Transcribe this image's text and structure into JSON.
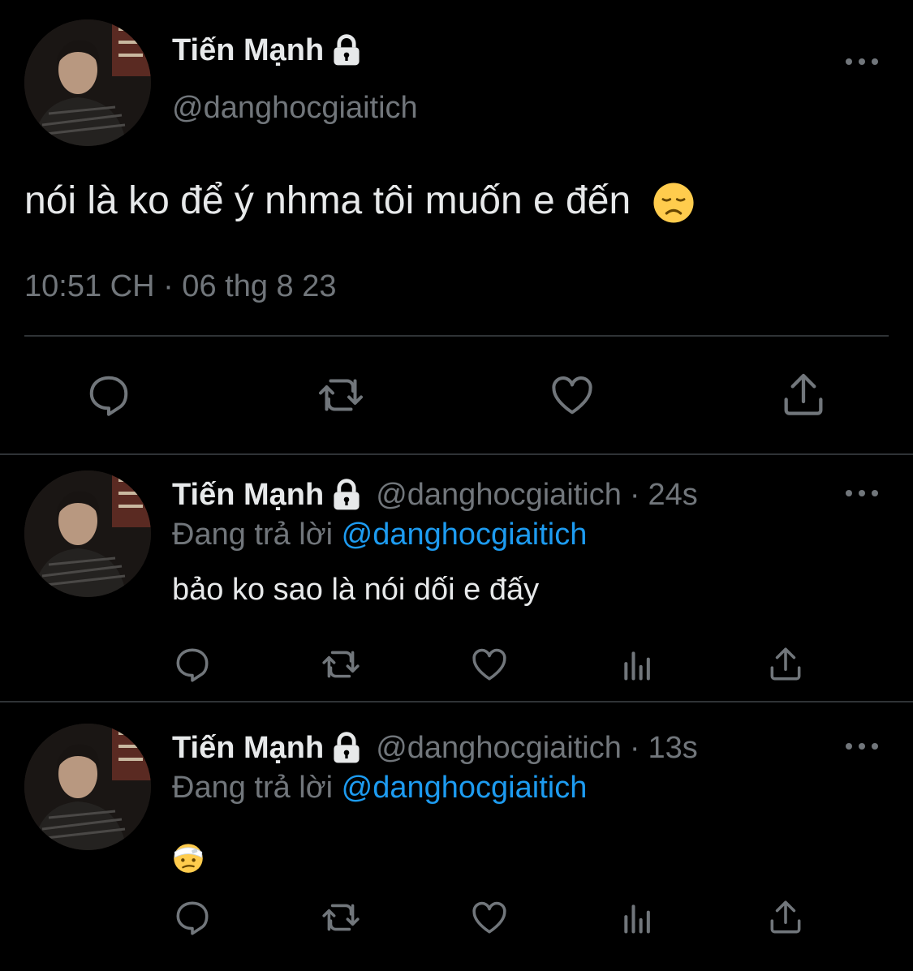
{
  "main_tweet": {
    "author": {
      "display_name": "Tiến Mạnh",
      "handle": "@danghocgiaitich",
      "protected_icon": "lock-icon",
      "avatar": "profile-photo"
    },
    "text": "nói là ko để ý nhma tôi muốn e đến",
    "emoji": "disappointed-face",
    "timestamp": "10:51 CH · 06 thg 8 23",
    "actions": [
      "reply-icon",
      "retweet-icon",
      "like-icon",
      "share-icon"
    ]
  },
  "replies": [
    {
      "display_name": "Tiến Mạnh",
      "handle": "@danghocgiaitich",
      "time_ago": "24s",
      "replying_to_label": "Đang trả lời",
      "replying_to_handle": "@danghocgiaitich",
      "text": "bảo ko sao là nói dối e đấy",
      "actions": [
        "reply-icon",
        "retweet-icon",
        "like-icon",
        "views-icon",
        "share-icon"
      ]
    },
    {
      "display_name": "Tiến Mạnh",
      "handle": "@danghocgiaitich",
      "time_ago": "13s",
      "replying_to_label": "Đang trả lời",
      "replying_to_handle": "@danghocgiaitich",
      "emoji": "face-with-head-bandage",
      "actions": [
        "reply-icon",
        "retweet-icon",
        "like-icon",
        "views-icon",
        "share-icon"
      ]
    }
  ],
  "colors": {
    "background": "#000000",
    "primary_text": "#e7e9ea",
    "secondary_text": "#71767b",
    "link": "#1d9bf0",
    "divider": "#2f3336"
  }
}
